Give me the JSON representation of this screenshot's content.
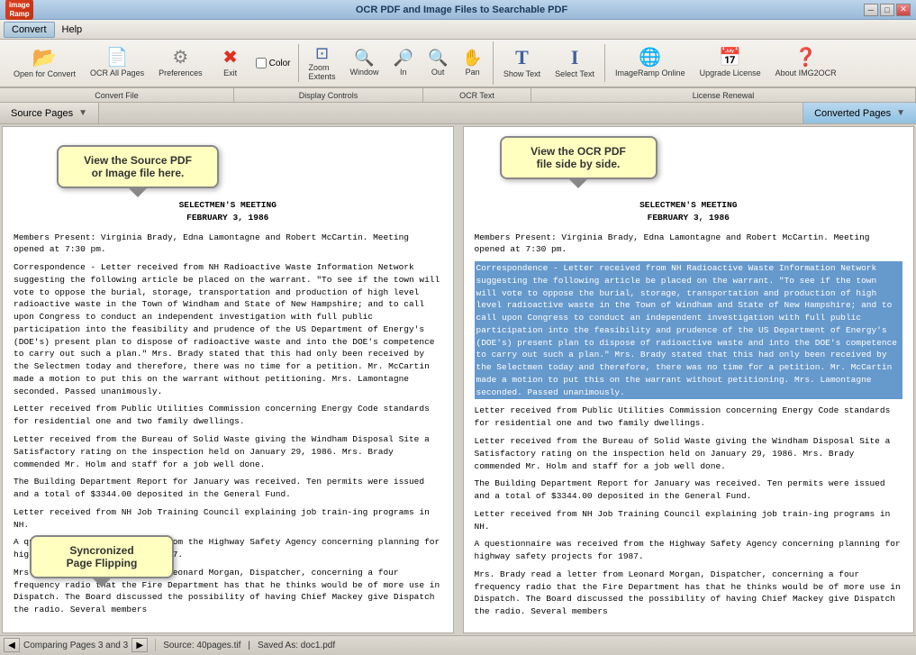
{
  "app": {
    "title": "OCR PDF and Image Files to Searchable PDF",
    "logo_text": "image\nRamp"
  },
  "titlebar": {
    "minimize": "─",
    "maximize": "□",
    "close": "✕"
  },
  "menu": {
    "items": [
      {
        "label": "Convert",
        "active": true
      },
      {
        "label": "Help",
        "active": false
      }
    ]
  },
  "toolbar": {
    "groups": [
      {
        "name": "convert-file",
        "label": "Convert File",
        "buttons": [
          {
            "id": "open-for-convert",
            "icon": "📂",
            "label": "Open for Convert"
          },
          {
            "id": "ocr-all-pages",
            "icon": "📄",
            "label": "OCR All Pages"
          },
          {
            "id": "preferences",
            "icon": "⚙",
            "label": "Preferences"
          },
          {
            "id": "exit",
            "icon": "✖",
            "label": "Exit"
          }
        ],
        "has_color": true,
        "color_label": "Color"
      },
      {
        "name": "display-controls",
        "label": "Display Controls",
        "buttons": [
          {
            "id": "zoom-extents",
            "icon": "⊡",
            "label": "Zoom\nExtents"
          },
          {
            "id": "window",
            "icon": "🔍",
            "label": "Window"
          },
          {
            "id": "in",
            "icon": "+",
            "label": "In"
          },
          {
            "id": "out",
            "icon": "−",
            "label": "Out"
          },
          {
            "id": "pan",
            "icon": "✋",
            "label": "Pan"
          }
        ]
      },
      {
        "name": "ocr-text",
        "label": "OCR Text",
        "buttons": [
          {
            "id": "show-text",
            "icon": "T",
            "label": "Show Text"
          },
          {
            "id": "select-text",
            "icon": "I",
            "label": "Select Text"
          }
        ]
      },
      {
        "name": "license-renewal",
        "label": "License Renewal",
        "buttons": [
          {
            "id": "imageramp-online",
            "icon": "🌐",
            "label": "ImageRamp Online"
          },
          {
            "id": "upgrade-license",
            "icon": "📅",
            "label": "Upgrade License"
          },
          {
            "id": "about-img2ocr",
            "icon": "❓",
            "label": "About IMG2OCR"
          }
        ]
      }
    ]
  },
  "panels": {
    "source_tab": "Source Pages",
    "converted_tab": "Converted Pages"
  },
  "callouts": {
    "source": "View the Source PDF\nor Image file here.",
    "ocr": "View the OCR PDF\nfile side by side.",
    "sync": "Syncronized\nPage Flipping"
  },
  "source_doc": {
    "title1": "SELECTMEN'S MEETING",
    "title2": "FEBRUARY 3, 1986",
    "paragraphs": [
      "Members Present: Virginia Brady, Edna Lamontagne and Robert McCartin.  Meeting opened at 7:30 pm.",
      "Correspondence - Letter received from NH Radioactive Waste Information Network suggesting the following article be placed on the warrant.  \"To see if the town will vote to oppose the burial, storage, transportation and production of high level radioactive waste in the Town of Windham and State of New Hampshire; and to call upon Congress to conduct an independent investigation with full public participation into the feasibility and prudence of the US Department of Energy's (DOE's) present plan to dispose of radioactive waste and into the DOE's competence to carry out such a plan.\"  Mrs. Brady stated that this had only been received by the Selectmen today and therefore, there was no time for a petition.  Mr. McCartin made a motion to put this on the warrant without petitioning.  Mrs. Lamontagne seconded.  Passed unanimously.",
      "Letter received from Public Utilities Commission concerning Energy Code standards for residential one and two family dwellings.",
      "Letter received from the Bureau of Solid Waste giving the Windham Disposal Site a Satisfactory rating on the inspection held on January 29, 1986.  Mrs. Brady commended Mr. Holm and staff for a job well done.",
      "The Building Department Report for January was received.  Ten permits were issued and a total of $3344.00 deposited in the General Fund.",
      "Letter received from NH Job Training Council explaining job train-ing programs in NH.",
      "A questionnaire was received from the Highway Safety Agency concerning planning for highway safety projects for 1987.",
      "Mrs. Brady read a letter from Leonard Morgan, Dispatcher, concerning a four frequency radio that the Fire Department has that he thinks would be of more use in Dispatch.  The Board discussed the possibility of having Chief Mackey give Dispatch the radio.  Several members"
    ]
  },
  "ocr_doc": {
    "title1": "SELECTMEN'S MEETING",
    "title2": "FEBRUARY 3, 1986",
    "paragraphs": [
      "Members Present: Virginia Brady, Edna Lamontagne and Robert McCartin.  Meeting opened at 7:30 pm.",
      "Correspondence - Letter received from NH Radioactive Waste Information Network suggesting the following article be placed on the warrant.  \"To see if the town will vote to oppose the burial, storage, transportation and production of high level radioactive waste in the Town of Windham and State of New Hampshire; and to call upon Congress to conduct an independent investigation with full public participation into the feasibility and prudence of the US Department of Energy's (DOE's) present plan to dispose of radioactive waste and into the DOE's competence to carry out such a plan.\"  Mrs. Brady stated that this had only been received by the Selectmen today and therefore, there was no time for a petition.  Mr. McCartin made a motion to put this on the warrant without petitioning.  Mrs. Lamontagne seconded.  Passed unanimously.",
      "Letter received from Public Utilities Commission concerning Energy Code standards for residential one and two family dwellings.",
      "Letter received from the Bureau of Solid Waste giving the Windham Disposal Site a Satisfactory rating on the inspection held on January 29, 1986.  Mrs. Brady commended Mr. Holm and staff for a job well done.",
      "The Building Department Report for January was received.  Ten permits were issued and a total of $3344.00 deposited in the General Fund.",
      "Letter received from NH Job Training Council explaining job train-ing programs in NH.",
      "A questionnaire was received from the Highway Safety Agency concerning planning for highway safety projects for 1987.",
      "Mrs. Brady read a letter from Leonard Morgan, Dispatcher, concerning a four frequency radio that the Fire Department has that he thinks would be of more use in Dispatch.  The Board discussed the possibility of having Chief Mackey give Dispatch the radio.  Several members"
    ]
  },
  "statusbar": {
    "page_label": "Comparing Pages 3 and 3",
    "source_label": "Source: 40pages.tif",
    "saved_label": "Saved As: doc1.pdf"
  }
}
